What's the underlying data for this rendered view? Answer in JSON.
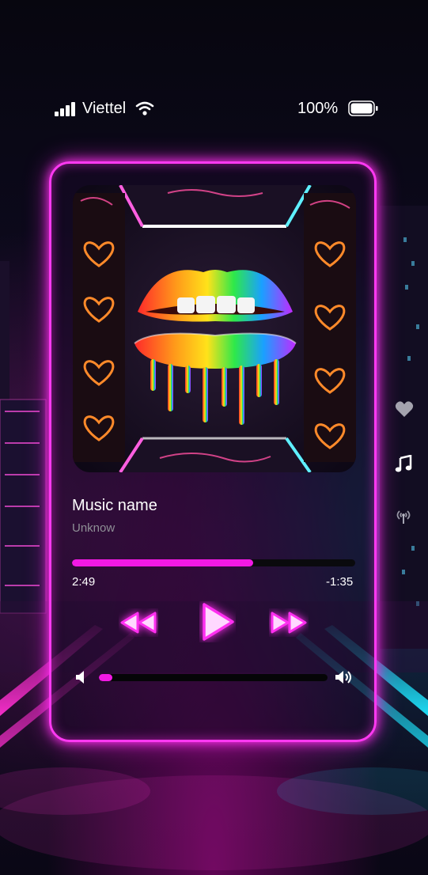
{
  "status_bar": {
    "carrier": "Viettel",
    "battery_percent": "100%"
  },
  "player": {
    "song_title": "Music name",
    "artist": "Unknow",
    "progress_fraction": 0.64,
    "time_elapsed": "2:49",
    "time_remaining": "-1:35",
    "volume_fraction": 0.06
  },
  "icons": {
    "signal": "cellular-signal-icon",
    "wifi": "wifi-icon",
    "battery": "battery-icon",
    "rewind": "rewind-icon",
    "play": "play-icon",
    "forward": "fast-forward-icon",
    "volume_low": "volume-low-icon",
    "volume_high": "volume-high-icon",
    "heart": "heart-icon",
    "note": "music-note-icon",
    "radio": "radio-broadcast-icon"
  },
  "colors": {
    "accent": "#f219e4",
    "frame_glow": "#ff39f2",
    "track": "#0a0a0d",
    "subtext": "#8f8f96"
  }
}
